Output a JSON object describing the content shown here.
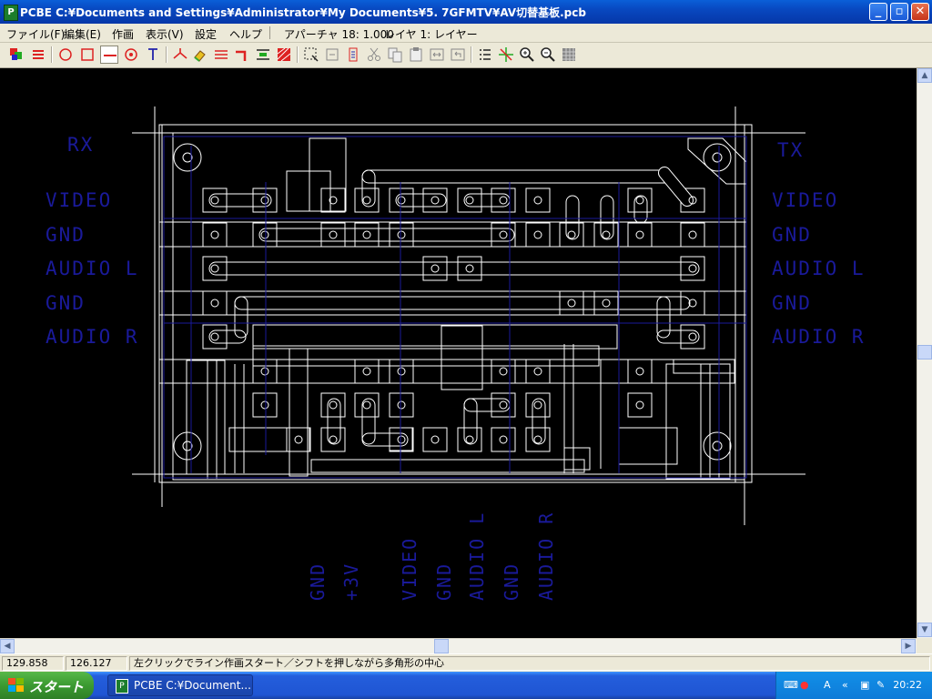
{
  "window": {
    "title": "PCBE  C:¥Documents and Settings¥Administrator¥My Documents¥5. 7GFMTV¥AV切替基板.pcb",
    "app_icon": "pcbe-app-icon",
    "controls": {
      "minimize": "_",
      "maximize": "▫",
      "close": "✕"
    }
  },
  "menu": {
    "items": [
      "ファイル(F)",
      "編集(E)",
      "作画",
      "表示(V)",
      "設定",
      "ヘルプ"
    ],
    "aperture": "アパーチャ 18: 1.000",
    "layer": "レイヤ 1: レイヤー"
  },
  "toolbar": {
    "icons": [
      "layers-icon",
      "rotate-icon",
      "circle-icon",
      "rectangle-icon",
      "line-icon",
      "target-icon",
      "text-icon",
      "junction-icon",
      "eraser-icon",
      "bus-icon",
      "corner-icon",
      "align-icon",
      "fill-icon",
      "select-icon",
      "copy-region-icon",
      "paste-region-icon",
      "cut-icon",
      "copy-icon",
      "paste-icon",
      "stretch-icon",
      "undo-icon",
      "list-icon",
      "snap-icon",
      "zoom-in-icon",
      "zoom-out-icon",
      "grid-icon"
    ]
  },
  "board": {
    "side_labels_left": [
      "RX",
      "VIDEO",
      "GND",
      "AUDIO L",
      "GND",
      "AUDIO R"
    ],
    "side_labels_right": [
      "TX",
      "VIDEO",
      "GND",
      "AUDIO L",
      "GND",
      "AUDIO R"
    ],
    "bottom_labels": [
      "GND",
      "+3V",
      "VIDEO",
      "GND",
      "AUDIO L",
      "GND",
      "AUDIO R"
    ],
    "colors": {
      "background": "#000000",
      "outline": "#ffffff",
      "silk": "#1a1a9a"
    }
  },
  "status": {
    "x": "129.858",
    "y": "126.127",
    "message": "左クリックでライン作画スタート／シフトを押しながら多角形の中心"
  },
  "taskbar": {
    "start_label": "スタート",
    "task_label": "PCBE  C:¥Document...",
    "ime": "A",
    "clock": "20:22"
  }
}
